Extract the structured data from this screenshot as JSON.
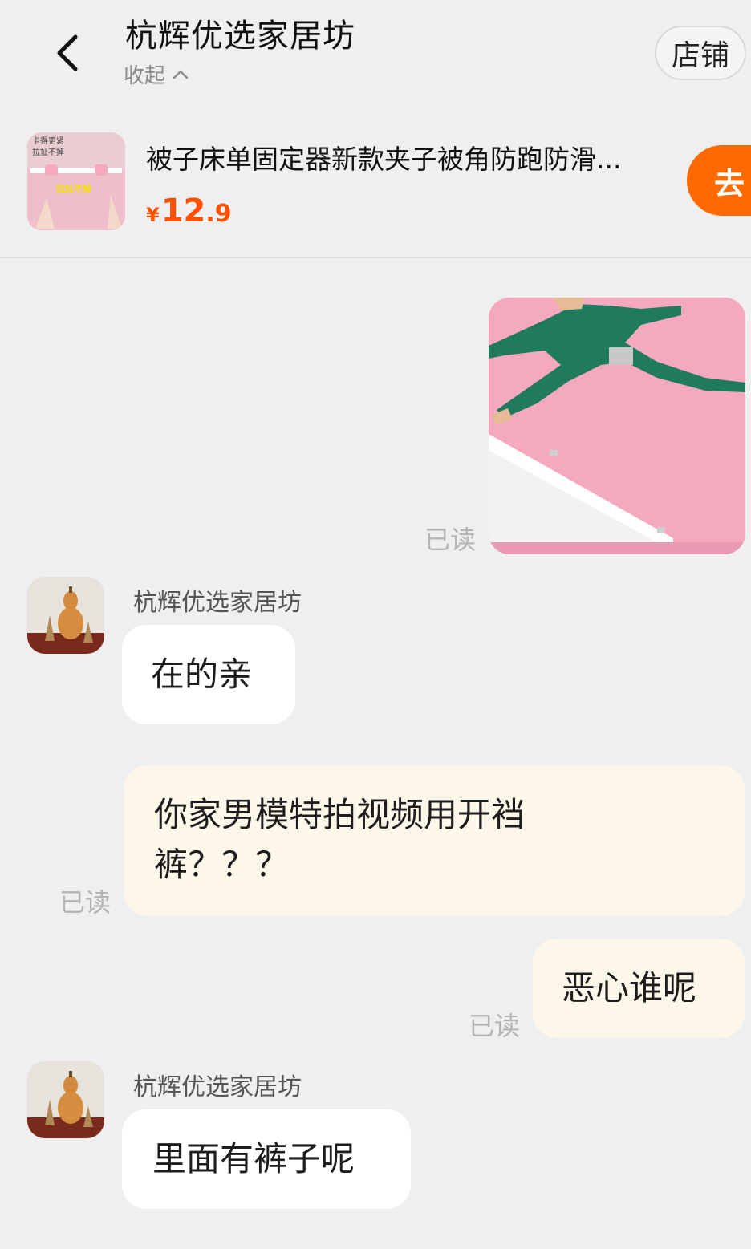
{
  "header": {
    "title": "杭辉优选家居坊",
    "collapse_label": "收起",
    "store_button": "店铺"
  },
  "product": {
    "title": "被子床单固定器新款夹子被角防跑防滑...",
    "price_symbol": "¥",
    "price_int": "12",
    "price_dec": ".9",
    "go_button": "去",
    "thumb_text_1": "卡得更紧",
    "thumb_text_2": "拉扯不掉",
    "thumb_text_3": "拉扯不掉"
  },
  "messages": {
    "read_label": "已读",
    "sender_name": "杭辉优选家居坊",
    "msg1": "在的亲",
    "msg2_line1": "你家男模特拍视频用开裆",
    "msg2_line2": "裤？？？",
    "msg3": "恶心谁呢",
    "msg4": "里面有裤子呢"
  },
  "colors": {
    "price": "#ff5000",
    "go_button": "#ff6a00",
    "self_bubble": "#fdf7e9",
    "other_bubble": "#ffffff",
    "background": "#efefef"
  },
  "icons": {
    "back": "chevron-left-icon",
    "collapse": "chevron-up-icon"
  }
}
